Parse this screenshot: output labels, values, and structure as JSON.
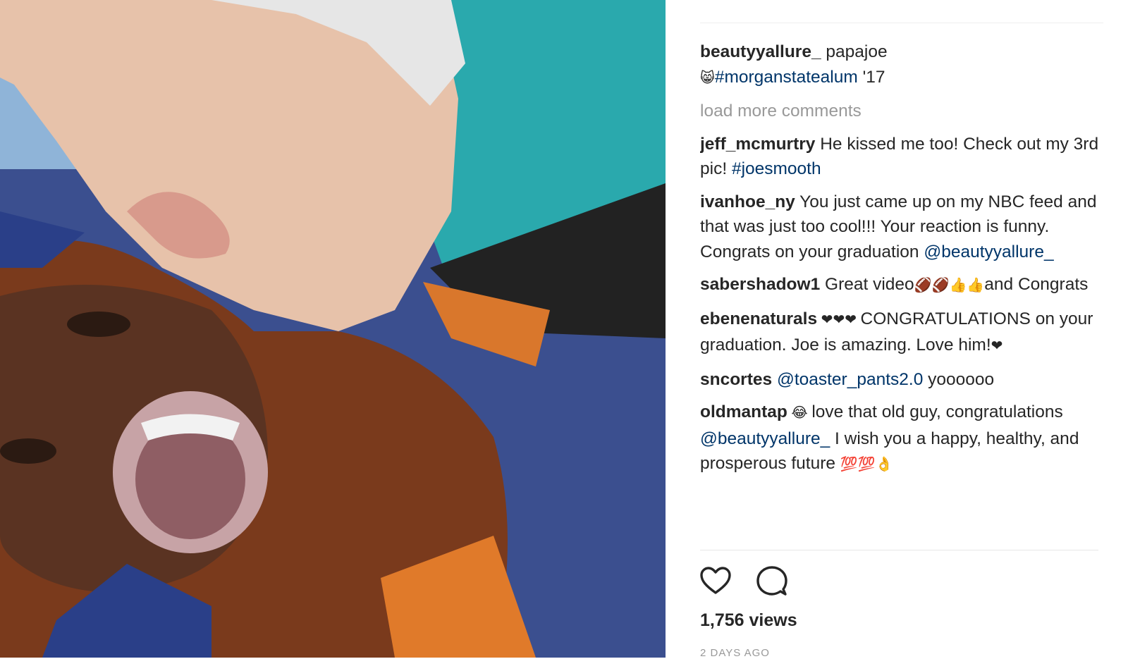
{
  "caption": {
    "username": "beautyyallure_",
    "text": "papajoe",
    "emoji": "😸",
    "hashtag": "#morganstatealum",
    "suffix": " '17"
  },
  "load_more": "load more comments",
  "comments": [
    {
      "username": "jeff_mcmurtry",
      "text": " He kissed me too! Check out my 3rd pic! ",
      "hashtag": "#joesmooth"
    },
    {
      "username": "ivanhoe_ny",
      "text": " You just came up on my NBC feed and that was just too cool!!! Your reaction is funny. Congrats on your graduation ",
      "mention": "@beautyyallure_"
    },
    {
      "username": "sabershadow1",
      "text": " Great video",
      "emojis": "🏈🏈👍👍",
      "text2": "and Congrats"
    },
    {
      "username": "ebenenaturals",
      "emojis": " ❤❤❤ ",
      "text": "CONGRATULATIONS on your graduation. Joe is amazing. Love him!",
      "emojis2": "❤"
    },
    {
      "username": "sncortes",
      "mention": " @toaster_pants2.0",
      "text": " yoooooo"
    },
    {
      "username": "oldmantap",
      "emojis": " 😂 ",
      "text": "love that old guy, congratulations ",
      "mention": "@beautyyallure_",
      "text2": " I wish you a happy, healthy, and prosperous future ",
      "emojis2": "💯💯👌"
    }
  ],
  "icons": {
    "like": "heart-icon",
    "comment": "comment-bubble-icon"
  },
  "views": "1,756 views",
  "timestamp": "2 DAYS AGO"
}
